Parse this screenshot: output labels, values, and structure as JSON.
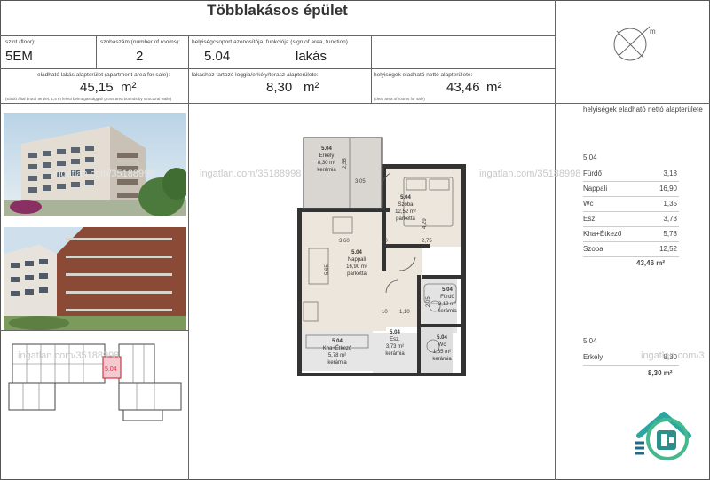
{
  "title": "Többlakásos épület",
  "floor": {
    "label": "szint (floor):",
    "value": "5EM"
  },
  "rooms": {
    "label": "szobaszám (number of rooms):",
    "value": "2"
  },
  "id": {
    "label": "helyiségcsoport azonosítója, funkciója (sign of area, function)",
    "code": "5.04",
    "function": "lakás"
  },
  "sale_area": {
    "label": "eladható lakás alapterület (apartment area for sale):",
    "value": "45,15",
    "unit": "m²",
    "note": "(Eladó által bruttó terület, 1,5 m feletti belmagassággal/ gross area bounds by structural walls)"
  },
  "loggia": {
    "label": "lakáshoz tartozó loggia/erkély/terasz alapterülete:",
    "value": "8,30",
    "unit": "m²"
  },
  "net_area": {
    "label": "helyiségek eladható nettó alapterülete:",
    "value": "43,46",
    "unit": "m²",
    "note": "(clear area of rooms for sale)"
  },
  "side": {
    "heading": "helyiségek eladható nettó alapterülete",
    "unit_code": "5.04",
    "rooms": [
      {
        "name": "Fürdő",
        "area": "3,18"
      },
      {
        "name": "Nappali",
        "area": "16,90"
      },
      {
        "name": "Wc",
        "area": "1,35"
      },
      {
        "name": "Esz.",
        "area": "3,73"
      },
      {
        "name": "Kha+Étkező",
        "area": "5,78"
      },
      {
        "name": "Szoba",
        "area": "12,52"
      }
    ],
    "total": "43,46 m²",
    "balcony_code": "5.04",
    "balcony": {
      "name": "Erkély",
      "area": "8,30"
    },
    "balcony_total": "8,30 m²"
  },
  "compass_label": "m",
  "watermarks": [
    "ingatlan.com/35188998",
    "ingatlan.com/35188998",
    "ingatlan.com/35188998",
    "ingatlan.com/35188998",
    "ingatlan.com/3"
  ],
  "key_plan_highlight": "5.04",
  "plan": {
    "rooms": [
      {
        "code": "5.04",
        "name": "Erkély",
        "area": "8,30 m²",
        "floor": "kerámia"
      },
      {
        "code": "5.04",
        "name": "Szoba",
        "area": "12,52 m²",
        "floor": "parketta"
      },
      {
        "code": "5.04",
        "name": "Nappali",
        "area": "16,90 m²",
        "floor": "parketta"
      },
      {
        "code": "5.04",
        "name": "Fürdő",
        "area": "3,18 m²",
        "floor": "kerámia"
      },
      {
        "code": "5.04",
        "name": "Esz.",
        "area": "3,73 m²",
        "floor": "kerámia"
      },
      {
        "code": "5.04",
        "name": "Kha+Étkező",
        "area": "5,78 m²",
        "floor": "kerámia"
      },
      {
        "code": "5.04",
        "name": "Wc",
        "area": "1,35 m²",
        "floor": "kerámia"
      }
    ],
    "dims": [
      "2,55",
      "3,05",
      "4,29",
      "3,60",
      "10",
      "2,75",
      "5,65",
      "1,10",
      "10",
      "2,05"
    ]
  }
}
